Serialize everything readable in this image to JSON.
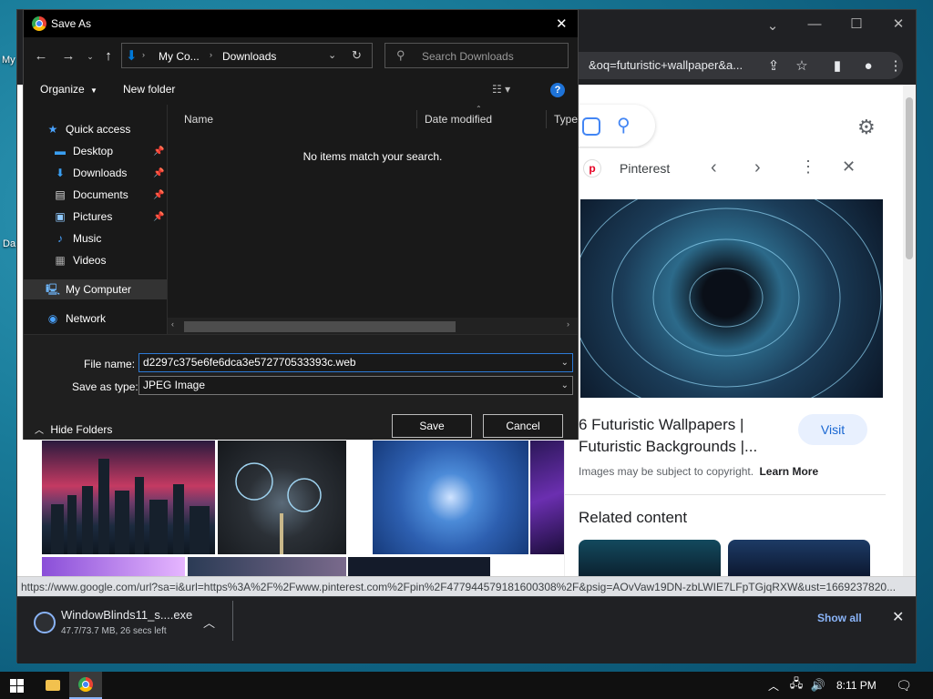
{
  "desktop": {
    "icon1_label": "My",
    "icon2_label": "Da"
  },
  "chrome": {
    "url_fragment": "&oq=futuristic+wallpaper&a...",
    "controls": {
      "minimize": "—",
      "maximize": "☐",
      "close": "✕",
      "chevron": "⌄"
    }
  },
  "side_panel": {
    "source": "Pinterest",
    "title_line1": "6 Futuristic Wallpapers |",
    "title_line2": "Futuristic Backgrounds |...",
    "visit": "Visit",
    "copyright": "Images may be subject to copyright.",
    "learn_more": "Learn More",
    "related": "Related content"
  },
  "status_url": "https://www.google.com/url?sa=i&url=https%3A%2F%2Fwww.pinterest.com%2Fpin%2F477944579181600308%2F&psig=AOvVaw19DN-zbLWIE7LFpTGjqRXW&ust=1669237820...",
  "download": {
    "filename": "WindowBlinds11_s....exe",
    "progress": "47.7/73.7 MB, 26 secs left",
    "show_all": "Show all"
  },
  "dialog": {
    "title": "Save As",
    "breadcrumb": [
      "My Co...",
      "Downloads"
    ],
    "search_placeholder": "Search Downloads",
    "organize": "Organize",
    "new_folder": "New folder",
    "tree": {
      "quick_access": "Quick access",
      "desktop": "Desktop",
      "downloads": "Downloads",
      "documents": "Documents",
      "pictures": "Pictures",
      "music": "Music",
      "videos": "Videos",
      "my_computer": "My Computer",
      "network": "Network"
    },
    "columns": {
      "name": "Name",
      "date": "Date modified",
      "type": "Type"
    },
    "empty_message": "No items match your search.",
    "file_name_label": "File name:",
    "file_name_value": "d2297c375e6fe6dca3e572770533393c.web",
    "save_type_label": "Save as type:",
    "save_type_value": "JPEG Image",
    "hide_folders": "Hide Folders",
    "save": "Save",
    "cancel": "Cancel"
  },
  "taskbar": {
    "time": "8:11 PM"
  },
  "colors": {
    "accent_blue": "#0078d7",
    "chrome_dark": "#202124",
    "dialog_bg": "#191919"
  }
}
